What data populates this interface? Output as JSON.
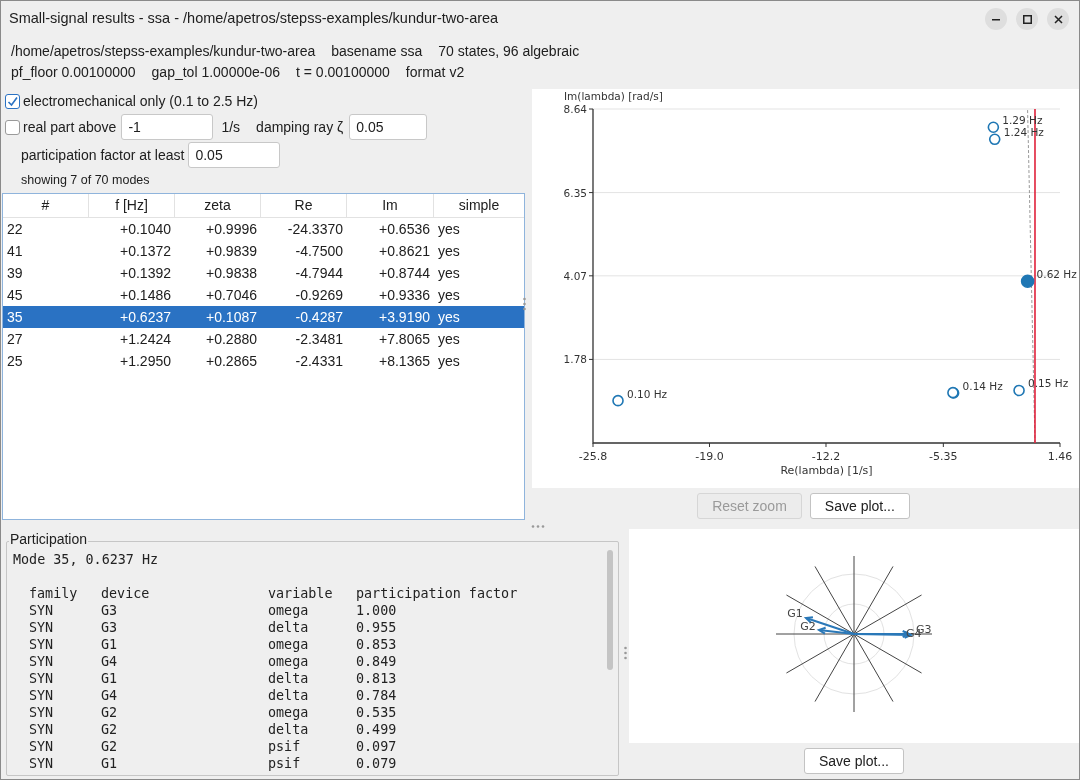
{
  "window": {
    "title": "Small-signal results - ssa - /home/apetros/stepss-examples/kundur-two-area"
  },
  "info": {
    "line_1": [
      "/home/apetros/stepss-examples/kundur-two-area",
      "basename ssa",
      "70 states, 96 algebraic"
    ],
    "line_2": [
      "pf_floor 0.00100000",
      "gap_tol 1.00000e-06",
      "t = 0.00100000",
      "format v2"
    ]
  },
  "filters": {
    "electromechanical": {
      "label": "electromechanical only (0.1 to 2.5 Hz)",
      "checked": true
    },
    "real_part": {
      "label": "real part above",
      "checked": false,
      "value": "-1",
      "unit": "1/s"
    },
    "damping": {
      "label": "damping ray ζ",
      "value": "0.05"
    },
    "participation": {
      "label": "participation factor at least",
      "value": "0.05"
    },
    "count": "showing 7 of 70 modes"
  },
  "table": {
    "columns": [
      "#",
      "f [Hz]",
      "zeta",
      "Re",
      "Im",
      "simple"
    ],
    "rows": [
      {
        "cells": [
          "22",
          "+0.1040",
          "+0.9996",
          "-24.3370",
          "+0.6536",
          "yes"
        ],
        "selected": false
      },
      {
        "cells": [
          "41",
          "+0.1372",
          "+0.9839",
          "-4.7500",
          "+0.8621",
          "yes"
        ],
        "selected": false
      },
      {
        "cells": [
          "39",
          "+0.1392",
          "+0.9838",
          "-4.7944",
          "+0.8744",
          "yes"
        ],
        "selected": false
      },
      {
        "cells": [
          "45",
          "+0.1486",
          "+0.7046",
          "-0.9269",
          "+0.9336",
          "yes"
        ],
        "selected": false
      },
      {
        "cells": [
          "35",
          "+0.6237",
          "+0.1087",
          "-0.4287",
          "+3.9190",
          "yes"
        ],
        "selected": true
      },
      {
        "cells": [
          "27",
          "+1.2424",
          "+0.2880",
          "-2.3481",
          "+7.8065",
          "yes"
        ],
        "selected": false
      },
      {
        "cells": [
          "25",
          "+1.2950",
          "+0.2865",
          "-2.4331",
          "+8.1365",
          "yes"
        ],
        "selected": false
      }
    ]
  },
  "eigen_plot": {
    "chart_data": {
      "type": "scatter",
      "xlabel": "Re(lambda)  [1/s]",
      "ylabel": "Im(lambda)  [rad/s]",
      "x": [
        -24.34,
        -4.75,
        -4.79,
        -0.93,
        -0.43,
        -2.35,
        -2.43
      ],
      "values": [
        0.65,
        0.86,
        0.87,
        0.93,
        3.92,
        7.81,
        8.14
      ],
      "grid": true,
      "ref_lines": [
        {
          "axis": "x",
          "value": 0,
          "color": "#e0203a"
        }
      ],
      "xlim": [
        -25.8,
        1.46
      ],
      "ylim": [
        -0.51,
        8.64
      ],
      "xticks": [
        {
          "value": -25.8,
          "label": "-25.8"
        },
        {
          "value": -19.0,
          "label": "-19.0"
        },
        {
          "value": -12.2,
          "label": "-12.2"
        },
        {
          "value": -5.35,
          "label": "-5.35"
        },
        {
          "value": 1.46,
          "label": "1.46"
        }
      ],
      "yticks": [
        1.78,
        4.07,
        6.35,
        8.64
      ],
      "annotations": [
        {
          "x": -24.34,
          "y": 0.65,
          "text": "0.10 Hz"
        },
        {
          "x": -4.75,
          "y": 0.86,
          "text": "0.14 Hz"
        },
        {
          "x": -0.93,
          "y": 0.93,
          "text": "0.15 Hz"
        },
        {
          "x": -0.43,
          "y": 3.92,
          "text": "0.62 Hz"
        },
        {
          "x": -2.35,
          "y": 7.81,
          "text": "1.24 Hz"
        },
        {
          "x": -2.43,
          "y": 8.14,
          "text": "1.29 Hz"
        }
      ]
    },
    "buttons": [
      {
        "label": "Reset zoom",
        "disabled": true
      },
      {
        "label": "Save plot...",
        "disabled": false
      }
    ]
  },
  "participation": {
    "title": "Participation",
    "mode": "Mode 35, 0.6237 Hz",
    "columns": [
      "family",
      "device",
      "variable",
      "participation factor"
    ],
    "rows": [
      [
        "SYN",
        "G3",
        "omega",
        "1.000"
      ],
      [
        "SYN",
        "G3",
        "delta",
        "0.955"
      ],
      [
        "SYN",
        "G1",
        "omega",
        "0.853"
      ],
      [
        "SYN",
        "G4",
        "omega",
        "0.849"
      ],
      [
        "SYN",
        "G1",
        "delta",
        "0.813"
      ],
      [
        "SYN",
        "G4",
        "delta",
        "0.784"
      ],
      [
        "SYN",
        "G2",
        "omega",
        "0.535"
      ],
      [
        "SYN",
        "G2",
        "delta",
        "0.499"
      ],
      [
        "SYN",
        "G2",
        "psif",
        "0.097"
      ],
      [
        "SYN",
        "G1",
        "psif",
        "0.079"
      ]
    ]
  },
  "mode_shape": {
    "labels": [
      "G1",
      "G2",
      "G3",
      "G4"
    ],
    "button": "Save plot..."
  }
}
